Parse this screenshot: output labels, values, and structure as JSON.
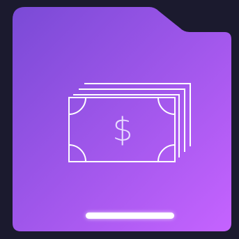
{
  "app": {
    "icon": "money-stack-icon",
    "currency_symbol": "$"
  },
  "colors": {
    "background": "#1b1a2e",
    "folder_gradient_start": "#7a4ad6",
    "folder_gradient_end": "#c563ff",
    "icon_stroke": "#ffffff",
    "home_indicator": "#ffffff"
  }
}
